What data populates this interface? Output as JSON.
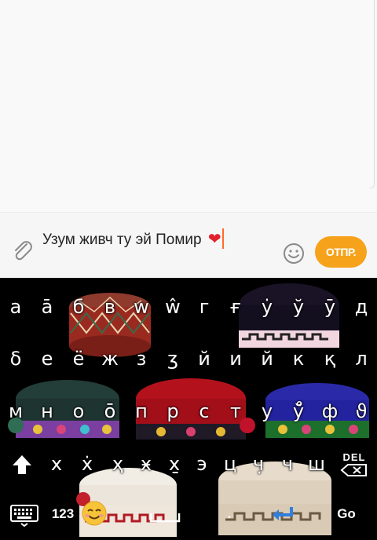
{
  "composer": {
    "message_text": "Узум живч ту эй Помир",
    "heart_emoji": "❤",
    "send_label": "ОТПР."
  },
  "keyboard": {
    "rows": [
      [
        "а",
        "ā",
        "б",
        "в",
        "w",
        "ŵ",
        "г",
        "ғ",
        "ẏ",
        "ў",
        "ӯ",
        "д"
      ],
      [
        "δ",
        "е",
        "ё",
        "ж",
        "з",
        "ʒ",
        "й",
        "и",
        "й",
        "к",
        "қ",
        "л"
      ],
      [
        "м",
        "н",
        "о",
        "ō",
        "п",
        "р",
        "с",
        "т",
        "у",
        "ў̊",
        "ф",
        "ϑ"
      ],
      [
        "х",
        "х̇",
        "ҳ",
        "ӿ",
        "х̱",
        "э",
        "ц",
        "ч̣",
        "ч",
        "ш"
      ]
    ],
    "del_label": "DEL",
    "num_label": "123",
    "go_label": "Go",
    "period_label": ".",
    "emoji_face": "☺"
  },
  "colors": {
    "send_button": "#f6a21b",
    "caret": "#ff6b2c",
    "enter_arrow": "#2f7fe0"
  }
}
